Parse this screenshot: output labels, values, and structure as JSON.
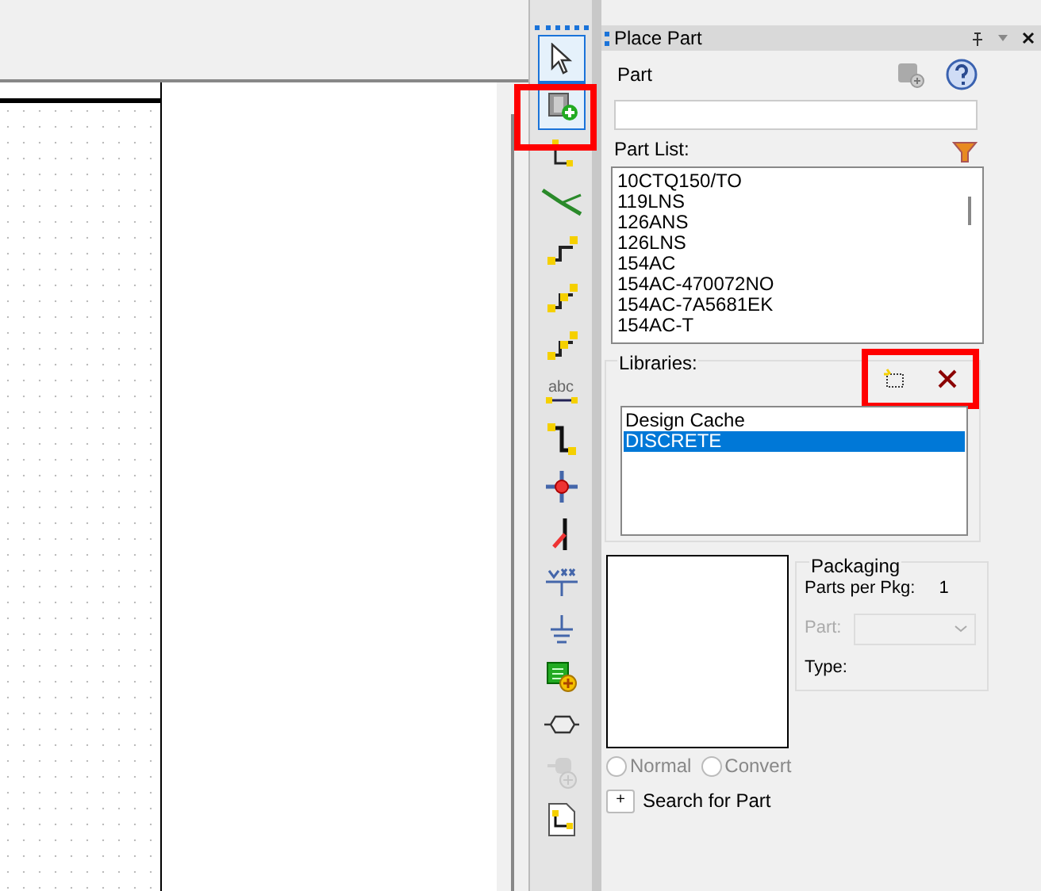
{
  "tools": [
    {
      "kind": "pointer",
      "selected": true,
      "disabled": false
    },
    {
      "kind": "part",
      "selected": true,
      "disabled": false
    },
    {
      "kind": "wire",
      "selected": false,
      "disabled": false
    },
    {
      "kind": "bus",
      "selected": false,
      "disabled": false
    },
    {
      "kind": "entry1",
      "selected": false,
      "disabled": false
    },
    {
      "kind": "entry2",
      "selected": false,
      "disabled": false
    },
    {
      "kind": "entry3",
      "selected": false,
      "disabled": false
    },
    {
      "kind": "text",
      "selected": false,
      "disabled": false
    },
    {
      "kind": "bend",
      "selected": false,
      "disabled": false
    },
    {
      "kind": "junction",
      "selected": false,
      "disabled": false
    },
    {
      "kind": "noconnect",
      "selected": false,
      "disabled": false
    },
    {
      "kind": "power",
      "selected": false,
      "disabled": false
    },
    {
      "kind": "ground",
      "selected": false,
      "disabled": false
    },
    {
      "kind": "block",
      "selected": false,
      "disabled": false
    },
    {
      "kind": "offpage",
      "selected": false,
      "disabled": false
    },
    {
      "kind": "pin",
      "selected": false,
      "disabled": true
    },
    {
      "kind": "page",
      "selected": false,
      "disabled": false
    }
  ],
  "abc": "abc",
  "panel": {
    "title": "Place Part",
    "part_label": "Part",
    "part_list_label": "Part List:",
    "parts": [
      "10CTQ150/TO",
      "119LNS",
      "126ANS",
      "126LNS",
      "154AC",
      "154AC-470072NO",
      "154AC-7A5681EK",
      "154AC-T"
    ],
    "libraries_label": "Libraries:",
    "libraries": [
      {
        "name": "Design Cache",
        "selected": false
      },
      {
        "name": "DISCRETE",
        "selected": true
      }
    ],
    "packaging": {
      "title": "Packaging",
      "parts_per_pkg_label": "Parts per Pkg:",
      "parts_per_pkg": "1",
      "part_label": "Part:",
      "type_label": "Type:"
    },
    "views": [
      {
        "label": "Normal",
        "selected": false
      },
      {
        "label": "Convert",
        "selected": false
      }
    ],
    "search_toggle": "+",
    "search_label": "Search for Part"
  }
}
